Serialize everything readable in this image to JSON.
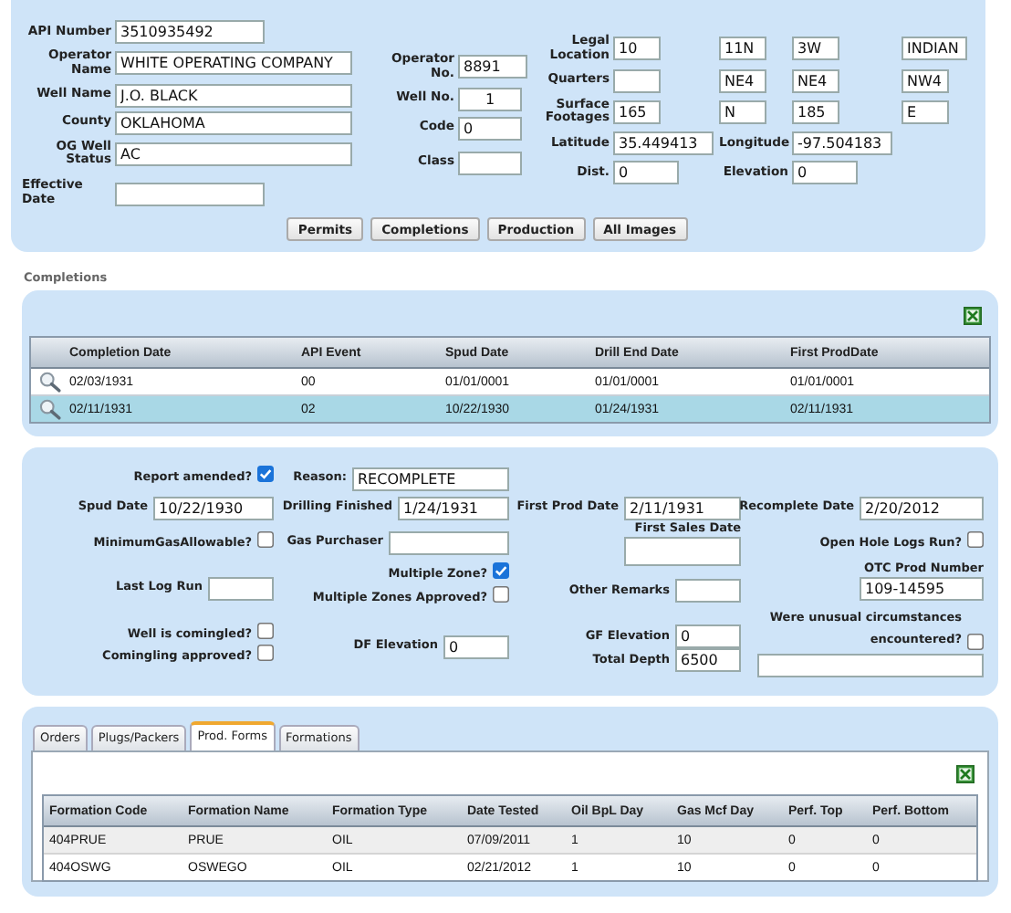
{
  "well": {
    "left": [
      {
        "label": "API Number",
        "value": "3510935492"
      },
      {
        "label": "Operator Name",
        "value": "WHITE OPERATING COMPANY"
      },
      {
        "label": "Well Name",
        "value": "J.O. BLACK"
      },
      {
        "label": "County",
        "value": "OKLAHOMA"
      },
      {
        "label": "OG Well Status",
        "value": "AC"
      },
      {
        "label": "Effective Date"
      }
    ],
    "middle": [
      {
        "label": "Operator No.",
        "value": "8891"
      },
      {
        "label": "Well No.",
        "value": "1"
      },
      {
        "label": "Code",
        "value": "0"
      },
      {
        "label": "Class"
      }
    ],
    "right": [
      {
        "kind": "quad",
        "label": "Legal Location",
        "fields": [
          {
            "value": "10"
          },
          {
            "value": "11N"
          },
          {
            "value": "3W"
          },
          {
            "value": "INDIAN"
          }
        ]
      },
      {
        "kind": "quad",
        "label": "Quarters",
        "fields": [
          {
            "empty": true
          },
          {
            "value": "NE4"
          },
          {
            "value": "NE4"
          },
          {
            "value": "NW4"
          }
        ]
      },
      {
        "kind": "quad",
        "label": "Surface Footages",
        "fields": [
          {
            "value": "165"
          },
          {
            "value": "N"
          },
          {
            "value": "185"
          },
          {
            "value": "E"
          }
        ]
      },
      {
        "kind": "pair",
        "items": [
          {
            "label": "Latitude",
            "value": "35.449413"
          },
          {
            "label": "Longitude",
            "value": "-97.504183"
          }
        ]
      },
      {
        "kind": "pair",
        "items": [
          {
            "label": "Dist.",
            "value": "0"
          },
          {
            "label": "Elevation",
            "value": "0"
          }
        ]
      }
    ]
  },
  "nav_buttons": [
    "Permits",
    "Completions",
    "Production",
    "All Images"
  ],
  "completions": {
    "heading": "Completions",
    "columns": [
      "Completion Date",
      "API Event",
      "Spud Date",
      "Drill End Date",
      "First ProdDate"
    ],
    "rows": [
      {
        "selected": false,
        "cells": [
          "02/03/1931",
          "00",
          "01/01/0001",
          "01/01/0001",
          "01/01/0001"
        ]
      },
      {
        "selected": true,
        "cells": [
          "02/11/1931",
          "02",
          "10/22/1930",
          "01/24/1931",
          "02/11/1931"
        ]
      }
    ]
  },
  "completion_detail": {
    "columns": [
      [
        {
          "kind": "checkbox",
          "label": "Report amended?",
          "checked": true
        },
        {
          "kind": "text",
          "label": "Spud Date",
          "value": "10/22/1930"
        },
        {
          "kind": "checkbox",
          "label": "MinimumGasAllowable?",
          "checked": false
        },
        {
          "kind": "text",
          "label": "Last Log Run"
        },
        {
          "kind": "checkbox",
          "label": "Well is comingled?",
          "checked": false
        },
        {
          "kind": "checkbox",
          "label": "Comingling approved?",
          "checked": false
        }
      ],
      [
        {
          "kind": "text",
          "label": "Reason:",
          "value": "RECOMPLETE"
        },
        {
          "kind": "text",
          "label": "Drilling Finished",
          "value": "1/24/1931"
        },
        {
          "kind": "text",
          "label": "Gas Purchaser"
        },
        {
          "kind": "checkbox",
          "label": "Multiple Zone?",
          "checked": true
        },
        {
          "kind": "checkbox",
          "label": "Multiple Zones Approved?",
          "checked": false
        },
        {
          "kind": "text",
          "label": "DF Elevation",
          "value": "0"
        }
      ],
      [
        {
          "kind": "text",
          "label": "First Prod Date",
          "value": "2/11/1931"
        },
        {
          "kind": "stacked",
          "label": "First Sales Date"
        },
        {
          "kind": "text",
          "label": "Other Remarks"
        },
        {
          "kind": "text",
          "label": "GF Elevation",
          "value": "0"
        },
        {
          "kind": "text",
          "label": "Total Depth",
          "value": "6500"
        }
      ],
      [
        {
          "kind": "text",
          "label": "Recomplete Date",
          "value": "2/20/2012"
        },
        {
          "kind": "checkbox",
          "label": "Open Hole Logs Run?",
          "checked": false
        },
        {
          "kind": "stacked",
          "label": "OTC Prod Number",
          "value": "109-14595"
        },
        {
          "kind": "checkbox_field",
          "label": "Were unusual circumstances encountered?",
          "checked": false
        }
      ]
    ]
  },
  "tabs": [
    {
      "label": "Orders",
      "selected": false
    },
    {
      "label": "Plugs/Packers",
      "selected": false
    },
    {
      "label": "Prod. Forms",
      "selected": true
    },
    {
      "label": "Formations",
      "selected": false
    }
  ],
  "prod_forms": {
    "columns": [
      "Formation Code",
      "Formation Name",
      "Formation Type",
      "Date Tested",
      "Oil BpL Day",
      "Gas Mcf Day",
      "Perf. Top",
      "Perf. Bottom"
    ],
    "rows": [
      {
        "cells": [
          "404PRUE",
          "PRUE",
          "OIL",
          "07/09/2011",
          "1",
          "10",
          "0",
          "0"
        ]
      },
      {
        "cells": [
          "404OSWG",
          "OSWEGO",
          "OIL",
          "02/21/2012",
          "1",
          "10",
          "0",
          "0"
        ]
      }
    ]
  }
}
